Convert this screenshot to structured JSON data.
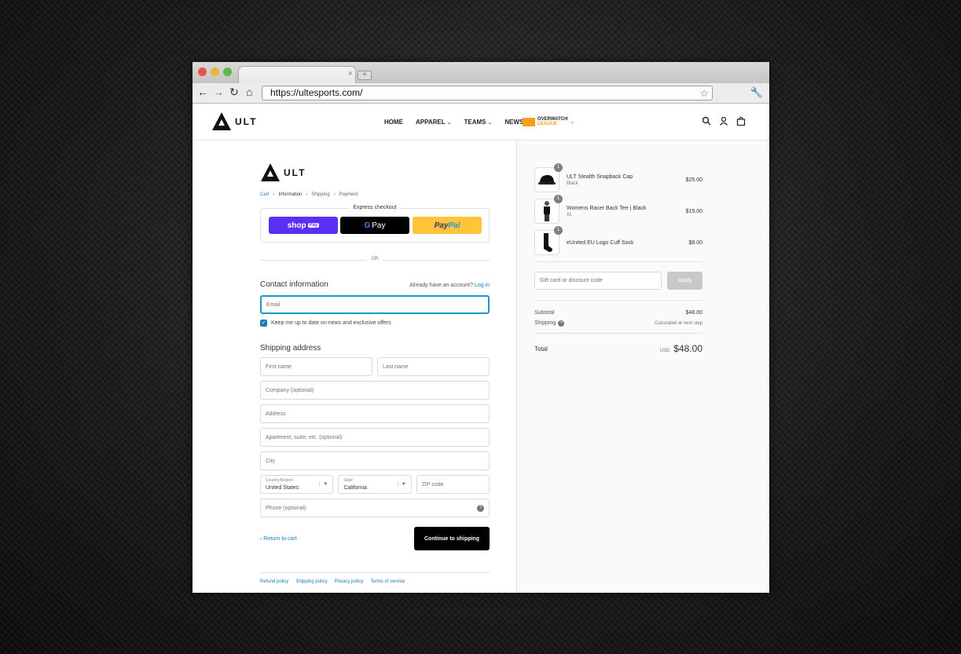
{
  "browser": {
    "url": "https://ultesports.com/",
    "tab_close": "×",
    "new_tab": "+"
  },
  "site": {
    "logo_text": "ULT",
    "nav": [
      {
        "label": "HOME"
      },
      {
        "label": "APPAREL"
      },
      {
        "label": "TEAMS"
      },
      {
        "label": "NEWS"
      }
    ],
    "owl_line1": "OVERWATCH",
    "owl_line2": "LEAGUE"
  },
  "checkout": {
    "logo_text": "ULT",
    "breadcrumbs": [
      "Cart",
      "Information",
      "Shipping",
      "Payment"
    ],
    "express_label": "Express checkout",
    "shop_pay": "shop",
    "shop_pay_pill": "Pay",
    "gpay_g": "G",
    "gpay_pay": "Pay",
    "paypal_a": "Pay",
    "paypal_b": "Pal",
    "or": "OR",
    "contact_title": "Contact information",
    "have_account": "Already have an account?",
    "login": "Log in",
    "email_placeholder": "Email",
    "newsletter_label": "Keep me up to date on news and exclusive offers",
    "shipping_title": "Shipping address",
    "first_name": "First name",
    "last_name": "Last name",
    "company": "Company (optional)",
    "address": "Address",
    "apartment": "Apartment, suite, etc. (optional)",
    "city": "City",
    "country_label": "Country/Region",
    "country_value": "United States",
    "state_label": "State",
    "state_value": "California",
    "zip": "ZIP code",
    "phone": "Phone (optional)",
    "back": "Return to cart",
    "continue": "Continue to shipping",
    "footer": [
      "Refund policy",
      "Shipping policy",
      "Privacy policy",
      "Terms of service"
    ]
  },
  "summary": {
    "items": [
      {
        "qty": "1",
        "name": "ULT Stealth Snapback Cap",
        "variant": "Black",
        "price": "$25.00"
      },
      {
        "qty": "1",
        "name": "Womens Racer Back Tee | Black",
        "variant": "XL",
        "price": "$15.00"
      },
      {
        "qty": "1",
        "name": "eUnited EU Logo Cuff Sock",
        "variant": "",
        "price": "$8.00"
      }
    ],
    "discount_placeholder": "Gift card or discount code",
    "apply": "Apply",
    "subtotal_label": "Subtotal",
    "subtotal": "$48.00",
    "shipping_label": "Shipping",
    "shipping_value": "Calculated at next step",
    "total_label": "Total",
    "currency": "USD",
    "total": "$48.00"
  }
}
